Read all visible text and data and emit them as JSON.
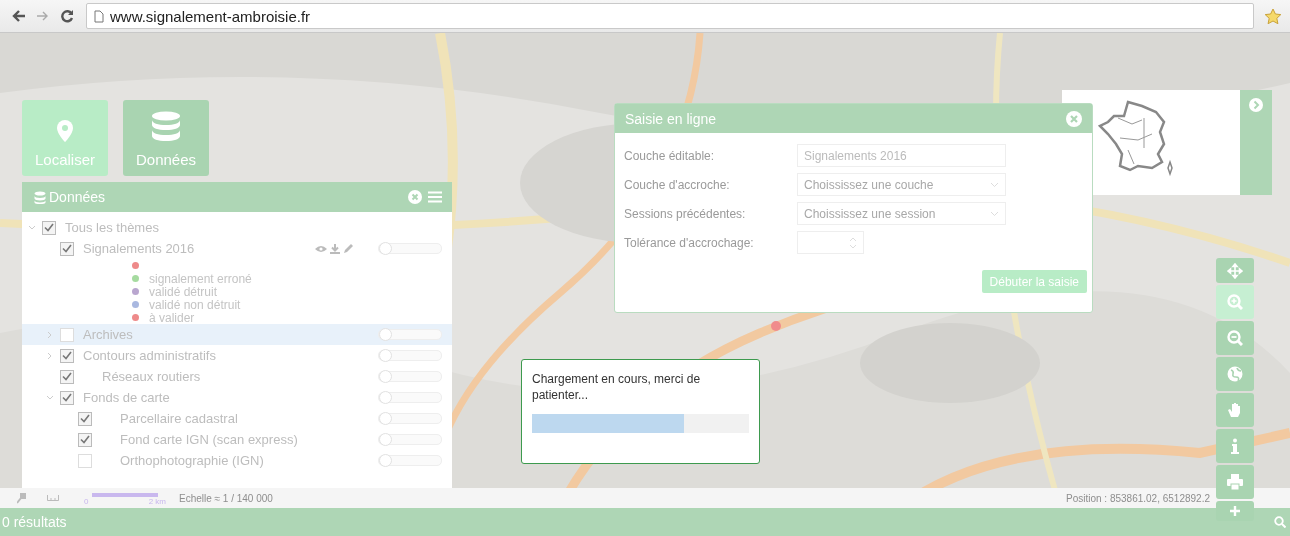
{
  "browser": {
    "url": "www.signalement-ambroisie.fr"
  },
  "tiles": [
    {
      "label": "Localiser",
      "kind": "pin",
      "selected": false
    },
    {
      "label": "Données",
      "kind": "database",
      "selected": true
    }
  ],
  "data_panel": {
    "title": "Données",
    "tree": [
      {
        "label": "Tous les thèmes",
        "checked": true,
        "expanded": true,
        "selected": false,
        "kind": "group",
        "children": [
          {
            "label": "Signalements 2016",
            "checked": true,
            "selected": false,
            "kind": "layer",
            "level": 0,
            "legend": [
              {
                "color": "#ee8a8a"
              },
              {
                "label": "signalement erroné",
                "color": "#a6dba0"
              },
              {
                "label": "validé détruit",
                "color": "#b9a6cf"
              },
              {
                "label": "validé non détruit",
                "color": "#a9b8e0"
              },
              {
                "label": "à valider",
                "color": "#ee8a8a"
              }
            ]
          },
          {
            "label": "Archives",
            "checked": false,
            "expanded": false,
            "selected": true,
            "kind": "group",
            "level": 0
          },
          {
            "label": "Contours administratifs",
            "checked": true,
            "expanded": false,
            "selected": false,
            "kind": "group",
            "level": 0
          },
          {
            "label": "Réseaux routiers",
            "checked": true,
            "selected": false,
            "kind": "layer",
            "level": 0
          },
          {
            "label": "Fonds de carte",
            "checked": true,
            "expanded": true,
            "selected": false,
            "kind": "group",
            "level": 0,
            "children": [
              {
                "label": "Parcellaire cadastral",
                "checked": true,
                "selected": false,
                "kind": "layer",
                "level": 0
              },
              {
                "label": "Fond carte IGN (scan express)",
                "checked": true,
                "selected": false,
                "kind": "layer",
                "level": 0
              },
              {
                "label": "Orthophotographie (IGN)",
                "checked": false,
                "selected": false,
                "kind": "layer",
                "level": 0
              }
            ]
          }
        ]
      }
    ]
  },
  "edit_dialog": {
    "title": "Saisie en ligne",
    "fields": [
      {
        "label": "Couche éditable:",
        "kind": "text",
        "value": "Signalements 2016"
      },
      {
        "label": "Couche d'accroche:",
        "kind": "select",
        "placeholder": "Choississez une couche"
      },
      {
        "label": "Sessions précédentes:",
        "kind": "select",
        "placeholder": "Choississez une session"
      },
      {
        "label": "Tolérance d'accrochage:",
        "kind": "number"
      }
    ],
    "button": "Débuter la saisie"
  },
  "loading": {
    "message": "Chargement en cours, merci de patienter...",
    "level": 0.7
  },
  "map_tools": [
    {
      "kind": "move",
      "selected": false
    },
    {
      "kind": "zoom-in",
      "selected": true
    },
    {
      "kind": "zoom-out",
      "selected": false
    },
    {
      "kind": "globe",
      "selected": false
    },
    {
      "kind": "hand",
      "selected": false
    },
    {
      "kind": "info",
      "selected": false
    },
    {
      "kind": "print",
      "selected": false
    },
    {
      "kind": "plus",
      "selected": false
    }
  ],
  "scale": {
    "start": "0",
    "end": "2 km",
    "text": "Echelle ≈ 1 / 140 000"
  },
  "position": "Position : 853861.02, 6512892.2",
  "results": "0 résultats"
}
